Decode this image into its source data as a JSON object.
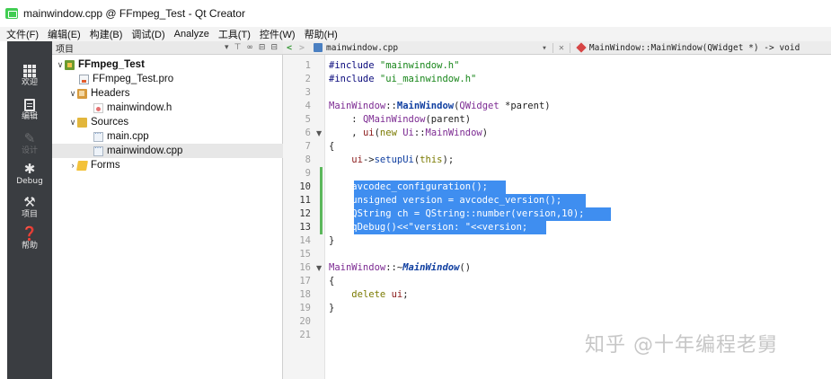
{
  "window": {
    "title": "mainwindow.cpp @ FFmpeg_Test - Qt Creator"
  },
  "menu": [
    "文件(F)",
    "编辑(E)",
    "构建(B)",
    "调试(D)",
    "Analyze",
    "工具(T)",
    "控件(W)",
    "帮助(H)"
  ],
  "modes": [
    {
      "label": "欢迎",
      "icon": "grid-icon"
    },
    {
      "label": "编辑",
      "icon": "edit-icon"
    },
    {
      "label": "设计",
      "icon": "pencil-icon"
    },
    {
      "label": "Debug",
      "icon": "bug-icon"
    },
    {
      "label": "项目",
      "icon": "wrench-icon"
    },
    {
      "label": "帮助",
      "icon": "help-icon"
    }
  ],
  "project_panel": {
    "title": "项目",
    "tree": [
      {
        "label": "FFmpeg_Test",
        "icon": "project-icon",
        "expanded": true
      },
      {
        "label": "FFmpeg_Test.pro",
        "icon": "pro-file-icon"
      },
      {
        "label": "Headers",
        "icon": "headers-folder-icon",
        "expanded": true
      },
      {
        "label": "mainwindow.h",
        "icon": "header-file-icon"
      },
      {
        "label": "Sources",
        "icon": "sources-folder-icon",
        "expanded": true
      },
      {
        "label": "main.cpp",
        "icon": "cpp-file-icon"
      },
      {
        "label": "mainwindow.cpp",
        "icon": "cpp-file-icon",
        "selected": true
      },
      {
        "label": "Forms",
        "icon": "forms-folder-icon",
        "expanded": false
      }
    ]
  },
  "editor": {
    "file": "mainwindow.cpp",
    "function": "MainWindow::MainWindow(QWidget *) -> void",
    "line_numbers": [
      "1",
      "2",
      "3",
      "4",
      "5",
      "6",
      "7",
      "8",
      "9",
      "10",
      "11",
      "12",
      "13",
      "14",
      "15",
      "16",
      "17",
      "18",
      "19",
      "20",
      "21"
    ],
    "lines": {
      "l1_a": "#include ",
      "l1_b": "\"mainwindow.h\"",
      "l2_a": "#include ",
      "l2_b": "\"ui_mainwindow.h\"",
      "l4_a": "MainWindow",
      "l4_b": "::",
      "l4_c": "MainWindow",
      "l4_d": "(",
      "l4_e": "QWidget",
      "l4_f": " *parent)",
      "l5_a": "    : ",
      "l5_b": "QMainWindow",
      "l5_c": "(parent)",
      "l6_a": "    , ",
      "l6_b": "ui",
      "l6_c": "(",
      "l6_d": "new",
      "l6_e": " ",
      "l6_f": "Ui",
      "l6_g": "::",
      "l6_h": "MainWindow",
      "l6_i": ")",
      "l7": "{",
      "l8_a": "    ",
      "l8_b": "ui",
      "l8_c": "->",
      "l8_d": "setupUi",
      "l8_e": "(",
      "l8_f": "this",
      "l8_g": ");",
      "l10": "    avcodec_configuration();",
      "l11": "    unsigned version = avcodec_version();",
      "l12": "    QString ch = QString::number(version,10);",
      "l13": "    qDebug()<<\"version: \"<<version;",
      "l14": "}",
      "l16_a": "MainWindow",
      "l16_b": "::~",
      "l16_c": "MainWindow",
      "l16_d": "()",
      "l17": "{",
      "l18_a": "    ",
      "l18_b": "delete",
      "l18_c": " ",
      "l18_d": "ui",
      "l18_e": ";",
      "l19": "}"
    }
  },
  "watermark": "知乎 @十年编程老舅"
}
